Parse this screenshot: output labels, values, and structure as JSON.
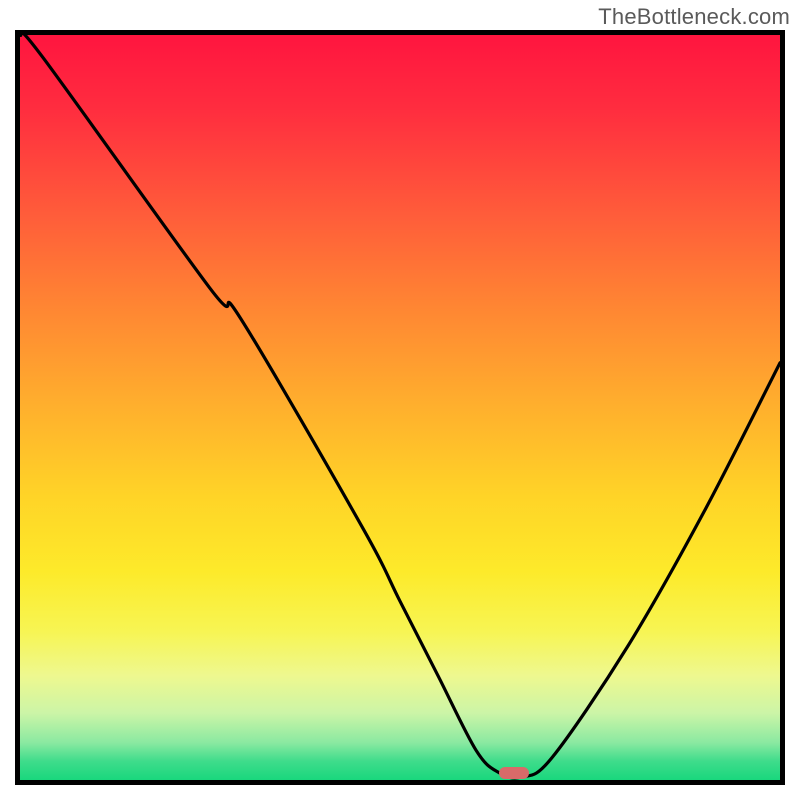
{
  "watermark": "TheBottleneck.com",
  "chart_data": {
    "type": "line",
    "title": "",
    "xlabel": "",
    "ylabel": "",
    "xlim": [
      0,
      100
    ],
    "ylim": [
      0,
      100
    ],
    "x": [
      0,
      3,
      25,
      29,
      45,
      50,
      55,
      60,
      63,
      66,
      70,
      80,
      90,
      100
    ],
    "y": [
      100,
      97,
      66,
      62,
      34,
      24,
      14,
      4,
      1,
      0.4,
      3,
      18,
      36,
      56
    ],
    "minimum_marker": {
      "x": 65,
      "y": 0.5,
      "color": "#d96a69"
    },
    "background_gradient": {
      "top": "#ff153f",
      "mid": "#ffd427",
      "bottom": "#19d77d"
    },
    "border_color": "#000000"
  }
}
